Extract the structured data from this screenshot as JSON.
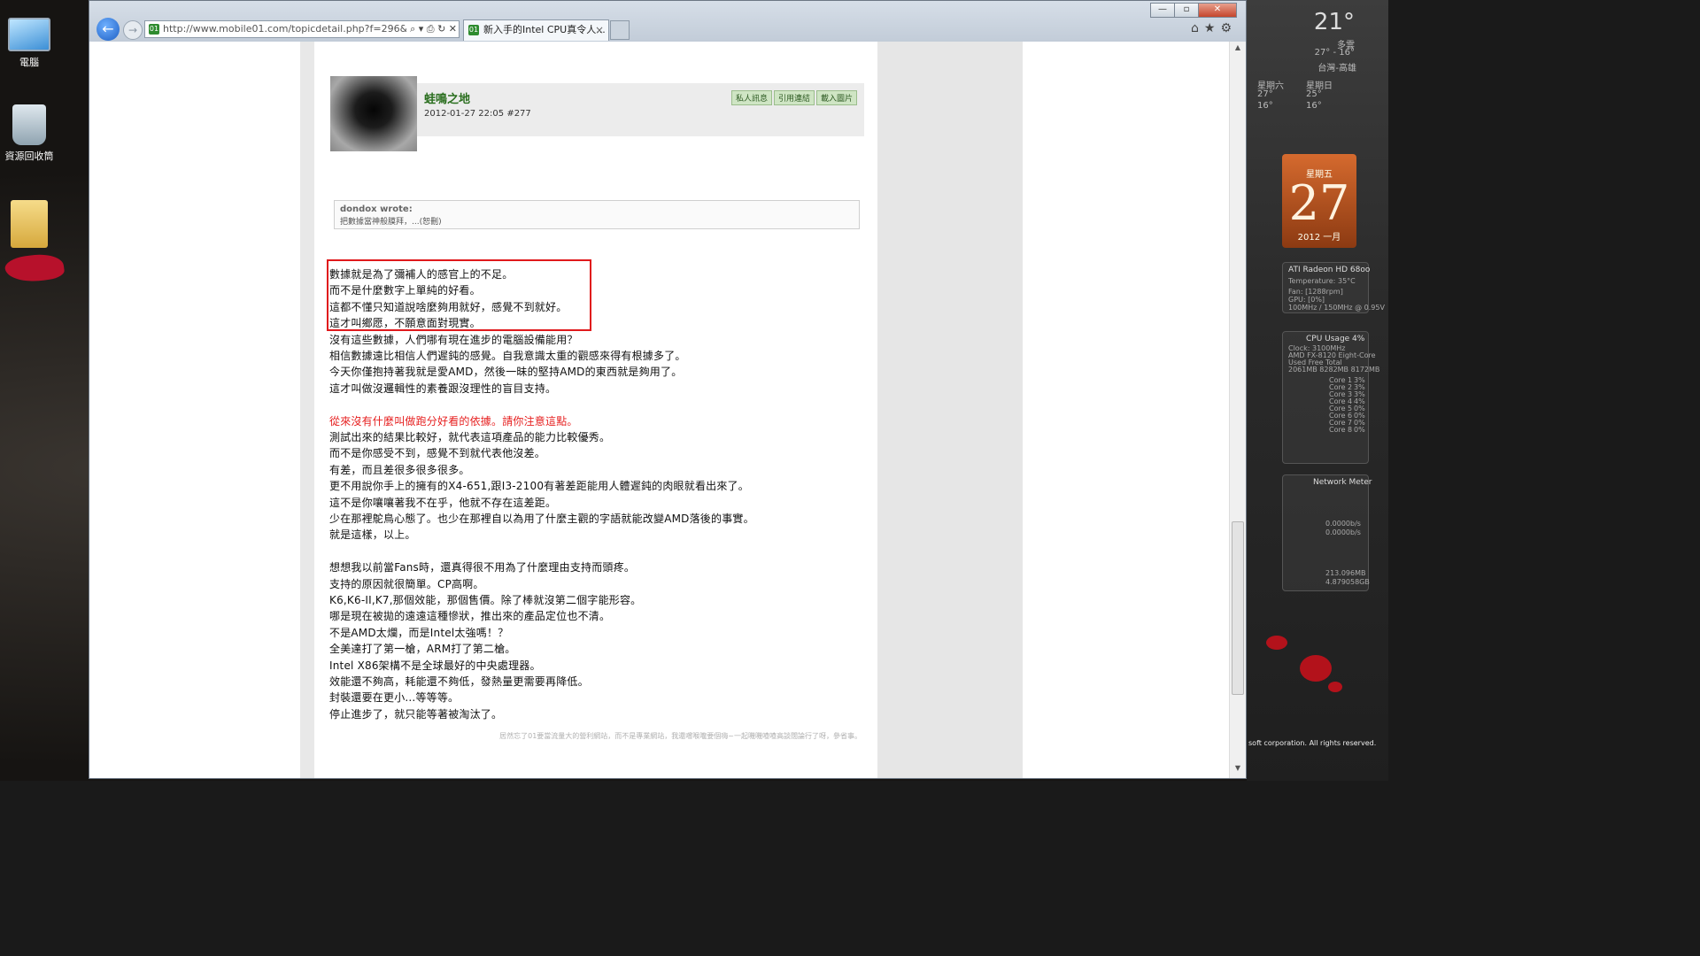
{
  "desktop": {
    "icons": [
      {
        "label": "電腦",
        "icon": "computer-icon"
      },
      {
        "label": "資源回收筒",
        "icon": "recycle-bin-icon"
      },
      {
        "label": "",
        "icon": "folder-icon"
      }
    ]
  },
  "browser": {
    "address": "http://www.mobile01.com/topicdetail.php?f=296&t=250",
    "tab_title": "新入手的Intel CPU真令人...",
    "window_buttons": {
      "minimize": "—",
      "maximize": "▫",
      "close": "✕"
    },
    "nav": {
      "back": "←",
      "forward": "→"
    },
    "command_icons": [
      "home-icon",
      "favorites-icon",
      "tools-icon"
    ]
  },
  "post": {
    "username": "蛙鳴之地",
    "datetime": "2012-01-27 22:05",
    "post_number": "#277",
    "actions": [
      "私人訊息",
      "引用連結",
      "載入圖片"
    ],
    "quote": {
      "author": "dondox wrote:",
      "text": "把數據當神般膜拜，...(恕刪)"
    },
    "lines": [
      "數據就是為了彌補人的感官上的不足。",
      "而不是什麼數字上單純的好看。",
      "這都不懂只知道說啥麼夠用就好，感覺不到就好。",
      "這才叫鄉愿，不願意面對現實。",
      "沒有這些數據，人們哪有現在進步的電腦設備能用？",
      "相信數據遠比相信人們遲鈍的感覺。自我意識太重的觀感來得有根據多了。",
      "今天你僅抱持著我就是愛AMD，然後一昧的堅持AMD的東西就是夠用了。",
      "這才叫做沒邏輯性的素養跟沒理性的盲目支持。",
      "",
      "從來沒有什麼叫做跑分好看的依據。請你注意這點。",
      "測試出來的結果比較好，就代表這項產品的能力比較優秀。",
      "而不是你感受不到，感覺不到就代表他沒差。",
      "有差，而且差很多很多很多。",
      "更不用說你手上的擁有的X4-651,跟I3-2100有著差距能用人體遲鈍的肉眼就看出來了。",
      "這不是你嚷嚷著我不在乎，他就不存在這差距。",
      "少在那裡鴕鳥心態了。也少在那裡自以為用了什麼主觀的字語就能改變AMD落後的事實。",
      "就是這樣，以上。",
      "",
      "想想我以前當Fans時，還真得很不用為了什麼理由支持而頭疼。",
      "支持的原因就很簡單。CP高啊。",
      "K6,K6-II,K7,那個效能，那個售價。除了棒就沒第二個字能形容。",
      "哪是現在被拋的遠遠這種慘狀，推出來的產品定位也不清。",
      "不是AMD太爛，而是Intel太強嗎！？",
      "全美達打了第一槍，ARM打了第二槍。",
      "Intel X86架構不是全球最好的中央處理器。",
      "效能還不夠高，耗能還不夠低，發熱量更需要再降低。",
      "封裝還要在更小...等等等。",
      "停止進步了，就只能等著被淘汰了。"
    ],
    "red_line_index": 9,
    "footer_note": "居然忘了01要當流量大的營利網站，而不是專業網站，我還嚐喉嚨要個嗨~一起嘰嘰喳喳高談闊論行了呀，參省事。"
  },
  "gadgets": {
    "weather": {
      "temp": "21°",
      "condition": "多雲",
      "range": "27° - 16°",
      "location": "台灣-高雄",
      "day1": "星期六",
      "day1_hi": "27°",
      "day1_lo": "16°",
      "day2": "星期日",
      "day2_hi": "25°",
      "day2_lo": "16°"
    },
    "calendar": {
      "weekday": "星期五",
      "date": "27",
      "month": "2012 一月"
    },
    "gpu": {
      "title": "ATI Radeon HD 68oo",
      "temp_label": "Temperature:",
      "temp": "35°C",
      "fan": "Fan: [1288rpm]",
      "gpu": "GPU: [0%]",
      "clock": "100MHz / 150MHz @ 0.95V"
    },
    "cpu": {
      "title": "CPU Usage",
      "percent": "4%",
      "model": "AMD FX-8120 Eight-Core",
      "clock": "Clock: 3100MHz",
      "mem": "Used  Free  Total",
      "mem_vals": "2061MB  8282MB  8172MB",
      "cores": [
        {
          "label": "Core 1",
          "value": "3%"
        },
        {
          "label": "Core 2",
          "value": "3%"
        },
        {
          "label": "Core 3",
          "value": "3%"
        },
        {
          "label": "Core 4",
          "value": "4%"
        },
        {
          "label": "Core 5",
          "value": "0%"
        },
        {
          "label": "Core 6",
          "value": "0%"
        },
        {
          "label": "Core 7",
          "value": "0%"
        },
        {
          "label": "Core 8",
          "value": "0%"
        }
      ]
    },
    "network": {
      "title": "Network Meter",
      "line1": "0.0000b/s",
      "line2": "0.0000b/s",
      "line3": "213.096MB",
      "line4": "4.879058GB"
    },
    "corp": "soft corporation. All rights reserved."
  }
}
